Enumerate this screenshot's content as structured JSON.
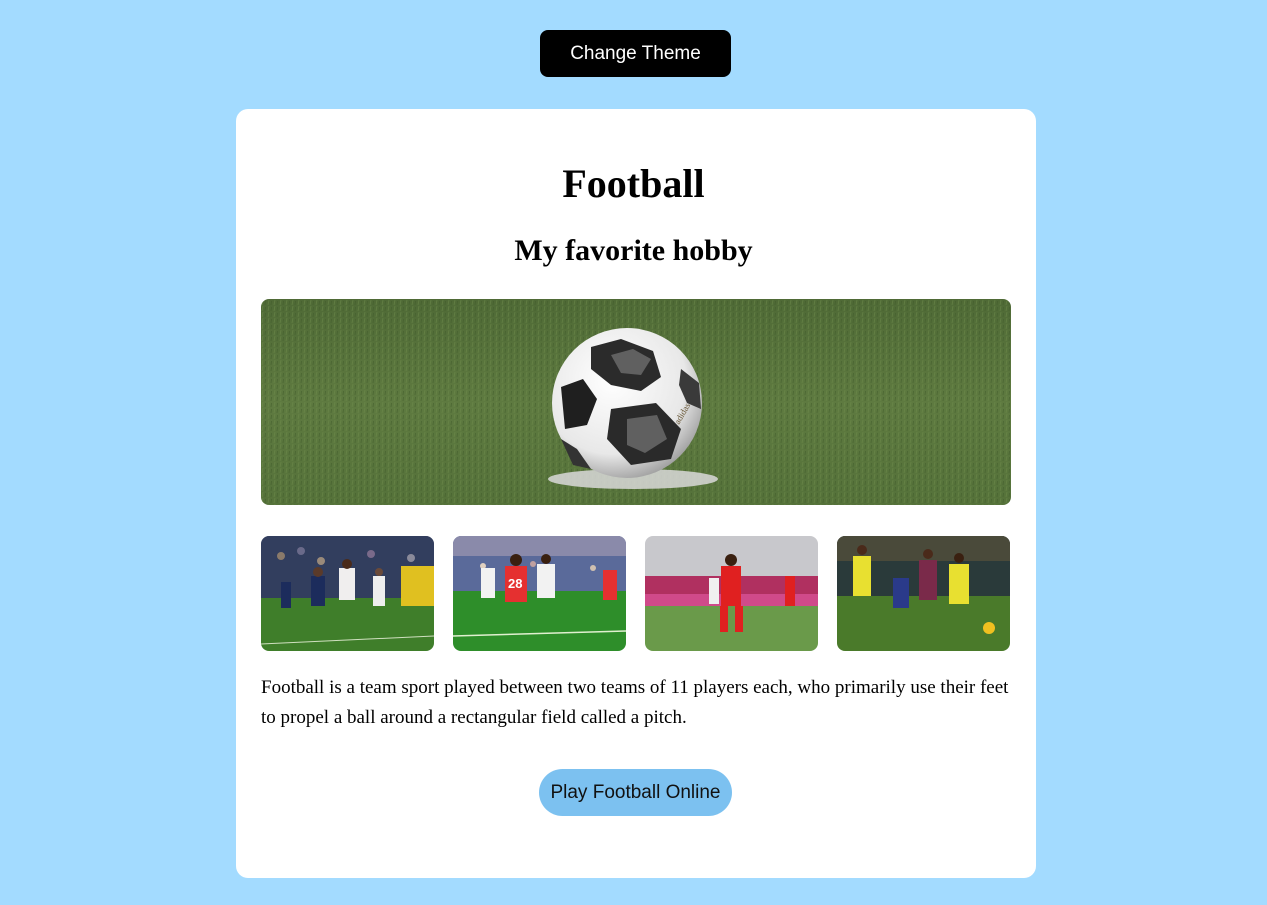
{
  "header": {
    "theme_button_label": "Change Theme"
  },
  "card": {
    "title": "Football",
    "subtitle": "My favorite hobby",
    "description": "Football is a team sport played between two teams of 11 players each, who primarily use their feet to propel a ball around a rectangular field called a pitch.",
    "play_button_label": "Play Football Online"
  },
  "images": {
    "hero": "soccer-ball-on-grass",
    "thumbnails": [
      "psg-match-action",
      "red-vs-white-match",
      "red-player-dribbling",
      "yellow-team-match"
    ]
  },
  "colors": {
    "background": "#a3dbff",
    "card": "#ffffff",
    "theme_button": "#000000",
    "play_button": "#7cc1f0"
  }
}
